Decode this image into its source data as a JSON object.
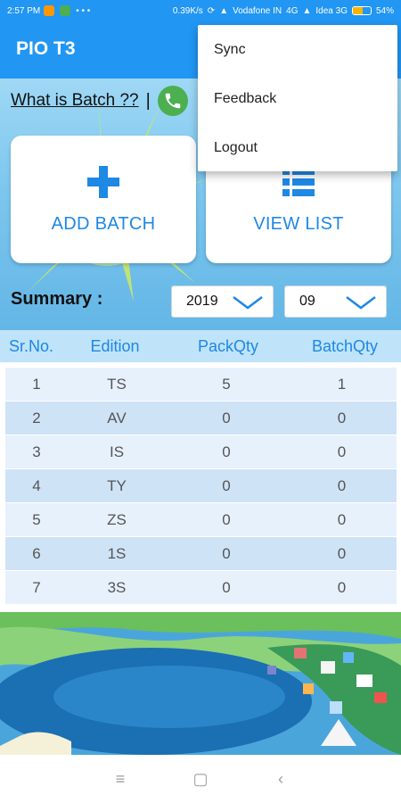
{
  "status_bar": {
    "time": "2:57 PM",
    "speed": "0.39K/s",
    "carrier1": "Vodafone IN",
    "net1": "4G",
    "carrier2": "Idea 3G",
    "battery_level": 0.54,
    "battery": "54%"
  },
  "app_bar": {
    "title": "PIO T3"
  },
  "batch_info": {
    "link": "What is Batch ??",
    "separator": "|"
  },
  "actions": {
    "add_batch": "ADD BATCH",
    "view_list": "VIEW LIST"
  },
  "summary": {
    "label": "Summary :",
    "year": "2019",
    "month": "09"
  },
  "table": {
    "headers": [
      "Sr.No.",
      "Edition",
      "PackQty",
      "BatchQty"
    ],
    "rows": [
      [
        "1",
        "TS",
        "5",
        "1"
      ],
      [
        "2",
        "AV",
        "0",
        "0"
      ],
      [
        "3",
        "IS",
        "0",
        "0"
      ],
      [
        "4",
        "TY",
        "0",
        "0"
      ],
      [
        "5",
        "ZS",
        "0",
        "0"
      ],
      [
        "6",
        "1S",
        "0",
        "0"
      ],
      [
        "7",
        "3S",
        "0",
        "0"
      ]
    ]
  },
  "overflow_menu": {
    "items": [
      "Sync",
      "Feedback",
      "Logout"
    ]
  },
  "nav": {
    "menu": "≡",
    "home": "▢",
    "back": "‹"
  },
  "colors": {
    "primary": "#2196F3",
    "accent": "#1E88E5",
    "whatsapp": "#4CAF50"
  }
}
